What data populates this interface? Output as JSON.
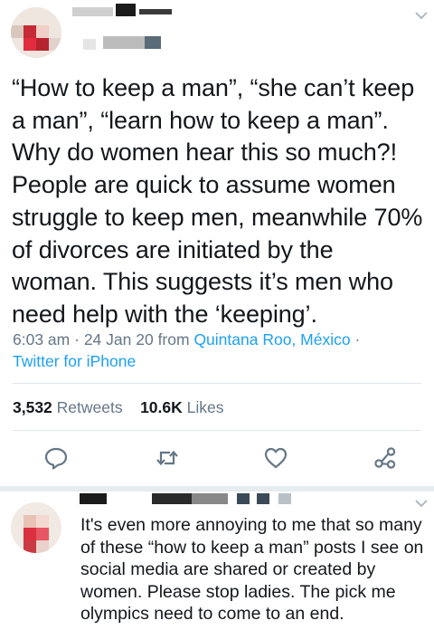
{
  "tweet": {
    "text": "“How to keep a man”, “she can’t keep a man”, “learn how to keep a man”. Why do women hear this so much?! People are quick to assume women struggle to keep men, meanwhile 70% of divorces are initiated by the woman. This suggests it’s men who need help with the ‘keeping’.",
    "time": "6:03 am",
    "date": "24 Jan 20",
    "from_label": "from",
    "location": "Quintana Roo, México",
    "source": "Twitter for iPhone",
    "retweets_count": "3,532",
    "retweets_label": "Retweets",
    "likes_count": "10.6K",
    "likes_label": "Likes"
  },
  "header_icons": {
    "chevron": "chevron-down-icon"
  },
  "actions": [
    {
      "name": "reply",
      "icon": "comment-icon"
    },
    {
      "name": "retweet",
      "icon": "retweet-icon"
    },
    {
      "name": "like",
      "icon": "heart-icon"
    },
    {
      "name": "share",
      "icon": "share-icon"
    }
  ],
  "reply": {
    "text": "It's even more annoying to me that so many of these “how to keep a man” posts I see on social media are shared or created by women. Please stop ladies. The pick me olympics need to come to an end."
  },
  "colors": {
    "text": "#14171a",
    "secondary": "#657786",
    "link": "#1da1f2",
    "divider": "#e1e8ed"
  }
}
